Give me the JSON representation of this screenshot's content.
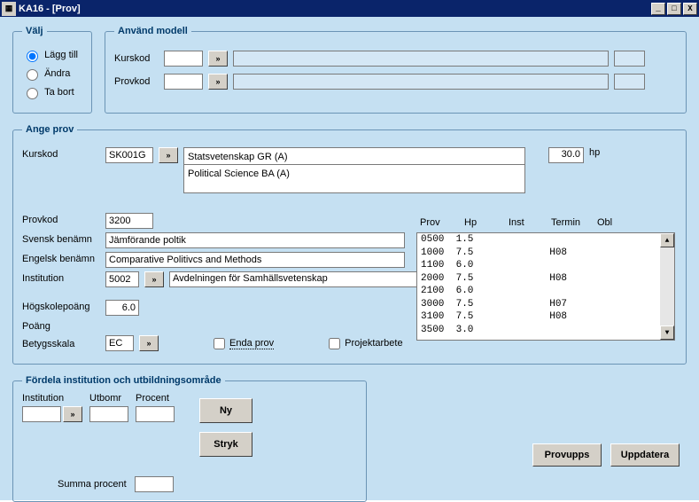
{
  "window": {
    "title": "KA16 - [Prov]"
  },
  "valj": {
    "legend": "Välj",
    "opt_add": "Lägg till",
    "opt_edit": "Ändra",
    "opt_del": "Ta bort"
  },
  "modell": {
    "legend": "Använd modell",
    "kurskod_label": "Kurskod",
    "provkod_label": "Provkod"
  },
  "ange": {
    "legend": "Ange prov",
    "kurskod_label": "Kurskod",
    "kurskod": "SK001G",
    "kursnamn_sv": "Statsvetenskap GR (A)",
    "kursnamn_en": "Political Science BA (A)",
    "hp_value": "30.0",
    "hp_unit": "hp",
    "provkod_label": "Provkod",
    "provkod": "3200",
    "svensk_label": "Svensk benämn",
    "svensk": "Jämförande poltik",
    "engelsk_label": "Engelsk benämn",
    "engelsk": "Comparative Politivcs and Methods",
    "inst_label": "Institution",
    "inst_code": "5002",
    "inst_name": "Avdelningen för Samhällsvetenskap",
    "hsp_label": "Högskolepoäng",
    "hsp": "6.0",
    "poang_label": "Poäng",
    "bskala_label": "Betygsskala",
    "bskala": "EC",
    "enda_prov": "Enda prov",
    "projektarbete": "Projektarbete"
  },
  "table": {
    "h_prov": "Prov",
    "h_hp": "Hp",
    "h_inst": "Inst",
    "h_termin": "Termin",
    "h_obl": "Obl",
    "rows": [
      {
        "prov": "0500",
        "hp": "1.5",
        "inst": "",
        "termin": ""
      },
      {
        "prov": "1000",
        "hp": "7.5",
        "inst": "",
        "termin": "H08"
      },
      {
        "prov": "1100",
        "hp": "6.0",
        "inst": "",
        "termin": ""
      },
      {
        "prov": "2000",
        "hp": "7.5",
        "inst": "",
        "termin": "H08"
      },
      {
        "prov": "2100",
        "hp": "6.0",
        "inst": "",
        "termin": ""
      },
      {
        "prov": "3000",
        "hp": "7.5",
        "inst": "",
        "termin": "H07"
      },
      {
        "prov": "3100",
        "hp": "7.5",
        "inst": "",
        "termin": "H08"
      },
      {
        "prov": "3500",
        "hp": "3.0",
        "inst": "",
        "termin": ""
      }
    ]
  },
  "fordela": {
    "legend": "Fördela institution och utbildningsområde",
    "col_inst": "Institution",
    "col_utb": "Utbomr",
    "col_proc": "Procent",
    "ny": "Ny",
    "stryk": "Stryk",
    "summa": "Summa procent"
  },
  "buttons": {
    "provupps": "Provupps",
    "uppdatera": "Uppdatera"
  }
}
